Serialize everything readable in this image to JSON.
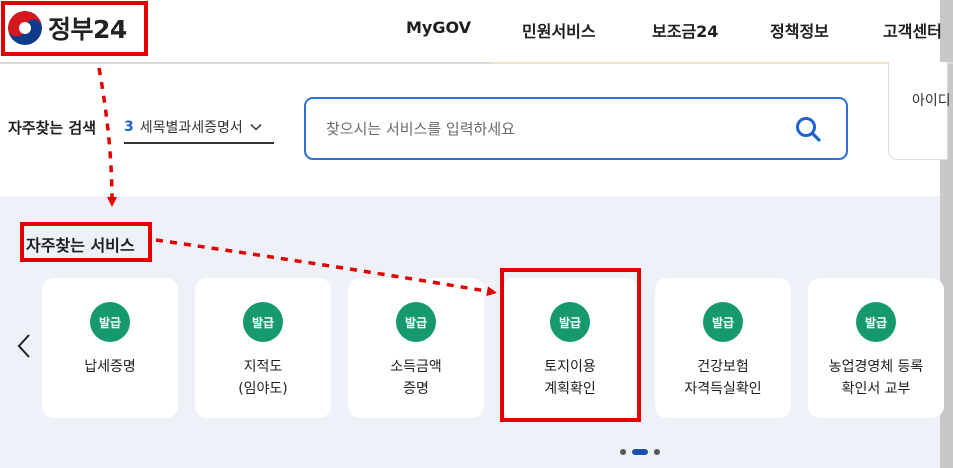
{
  "header": {
    "logo_text": "정부24",
    "nav": [
      {
        "label": "MyGOV"
      },
      {
        "label": "민원서비스"
      },
      {
        "label": "보조금24"
      },
      {
        "label": "정책정보"
      },
      {
        "label": "고객센터"
      }
    ]
  },
  "search": {
    "fav_label": "자주찾는 검색",
    "fav_rank": "3",
    "fav_term": "세목별과세증명서",
    "placeholder": "찾으시는 서비스를 입력하세요"
  },
  "login": {
    "text": "아이디"
  },
  "services": {
    "title": "자주찾는 서비스",
    "cards": [
      {
        "badge": "발급",
        "line1": "납세증명",
        "line2": ""
      },
      {
        "badge": "발급",
        "line1": "지적도",
        "line2": "(임야도)"
      },
      {
        "badge": "발급",
        "line1": "소득금액",
        "line2": "증명"
      },
      {
        "badge": "발급",
        "line1": "토지이용",
        "line2": "계획확인"
      },
      {
        "badge": "발급",
        "line1": "건강보험",
        "line2": "자격득실확인"
      },
      {
        "badge": "발급",
        "line1": "농업경영체 등록",
        "line2": "확인서 교부"
      }
    ]
  },
  "colors": {
    "accent_blue": "#2a6fdb",
    "badge_green": "#169a6b",
    "annotation_red": "#e30000",
    "active_dot": "#1f4fa8"
  }
}
